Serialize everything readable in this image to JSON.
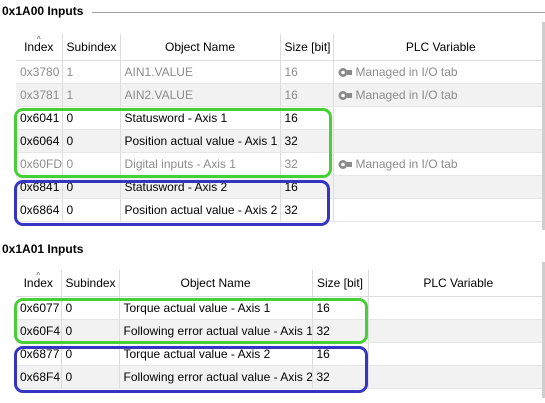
{
  "colors": {
    "highlight_green": "#47d035",
    "highlight_blue": "#3535c4",
    "disabled_text": "#8c8c8c",
    "alt_row": "#f2f2f2"
  },
  "section1": {
    "title": "0x1A00 Inputs",
    "columns": [
      "Index",
      "Subindex",
      "Object Name",
      "Size [bit]",
      "PLC Variable"
    ],
    "rows": [
      {
        "index": "0x3780",
        "subindex": "1",
        "name": "AIN1.VALUE",
        "size": "16",
        "plc": "Managed in I/O tab",
        "plc_icon": "managed-io-icon"
      },
      {
        "index": "0x3781",
        "subindex": "1",
        "name": "AIN2.VALUE",
        "size": "16",
        "plc": "Managed in I/O tab",
        "plc_icon": "managed-io-icon"
      },
      {
        "index": "0x6041",
        "subindex": "0",
        "name": "Statusword - Axis 1",
        "size": "16",
        "plc": ""
      },
      {
        "index": "0x6064",
        "subindex": "0",
        "name": "Position actual value - Axis 1",
        "size": "32",
        "plc": ""
      },
      {
        "index": "0x60FD",
        "subindex": "0",
        "name": "Digital inputs - Axis 1",
        "size": "32",
        "plc": "Managed in I/O tab",
        "plc_icon": "managed-io-icon"
      },
      {
        "index": "0x6841",
        "subindex": "0",
        "name": "Statusword - Axis 2",
        "size": "16",
        "plc": ""
      },
      {
        "index": "0x6864",
        "subindex": "0",
        "name": "Position actual value - Axis 2",
        "size": "32",
        "plc": ""
      }
    ]
  },
  "section2": {
    "title": "0x1A01 Inputs",
    "columns": [
      "Index",
      "Subindex",
      "Object Name",
      "Size [bit]",
      "PLC Variable"
    ],
    "rows": [
      {
        "index": "0x6077",
        "subindex": "0",
        "name": "Torque actual value - Axis 1",
        "size": "16",
        "plc": ""
      },
      {
        "index": "0x60F4",
        "subindex": "0",
        "name": "Following error actual value - Axis 1",
        "size": "32",
        "plc": ""
      },
      {
        "index": "0x6877",
        "subindex": "0",
        "name": "Torque actual value - Axis 2",
        "size": "16",
        "plc": ""
      },
      {
        "index": "0x68F4",
        "subindex": "0",
        "name": "Following error actual value - Axis 2",
        "size": "32",
        "plc": ""
      }
    ]
  }
}
